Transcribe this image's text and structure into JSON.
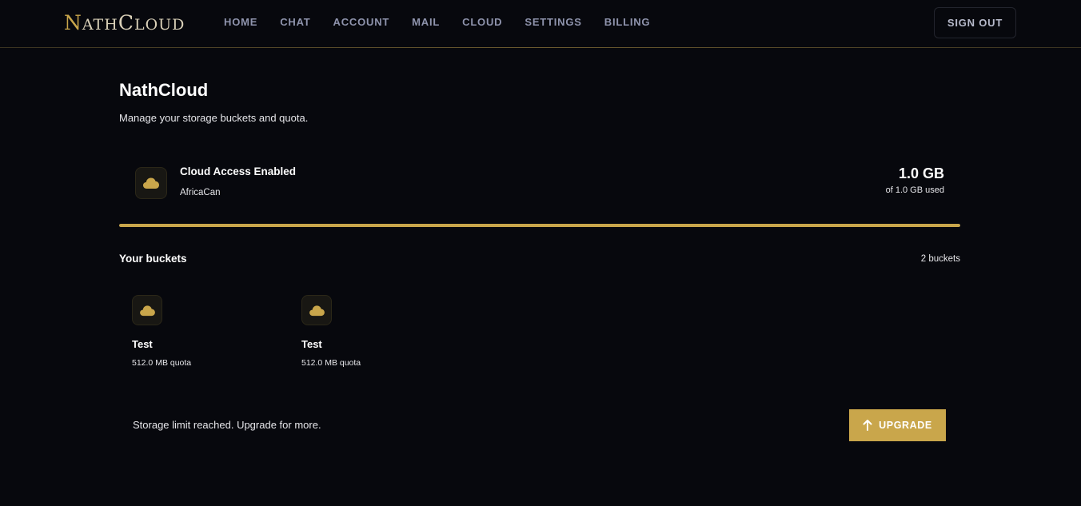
{
  "header": {
    "logo_first": "N",
    "logo_mid1": "ATH",
    "logo_second": "C",
    "logo_mid2": "LOUD",
    "nav": [
      "HOME",
      "CHAT",
      "ACCOUNT",
      "MAIL",
      "CLOUD",
      "SETTINGS",
      "BILLING"
    ],
    "sign_out": "SIGN OUT"
  },
  "page": {
    "title": "NathCloud",
    "subtitle": "Manage your storage buckets and quota."
  },
  "access": {
    "title": "Cloud Access Enabled",
    "account": "AfricaCan",
    "used": "1.0 GB",
    "used_of": "of 1.0 GB used",
    "usage_fraction": 1.0
  },
  "buckets": {
    "title": "Your buckets",
    "count": "2 buckets",
    "items": [
      {
        "name": "Test",
        "quota": "512.0 MB quota"
      },
      {
        "name": "Test",
        "quota": "512.0 MB quota"
      }
    ]
  },
  "footer": {
    "limit_message": "Storage limit reached. Upgrade for more.",
    "upgrade_label": "UPGRADE"
  },
  "colors": {
    "accent": "#c9a64b",
    "background": "#07080d",
    "nav_text": "#8f94ad"
  },
  "icons": {
    "cloud": "cloud-icon",
    "upgrade": "arrow-up-icon"
  }
}
